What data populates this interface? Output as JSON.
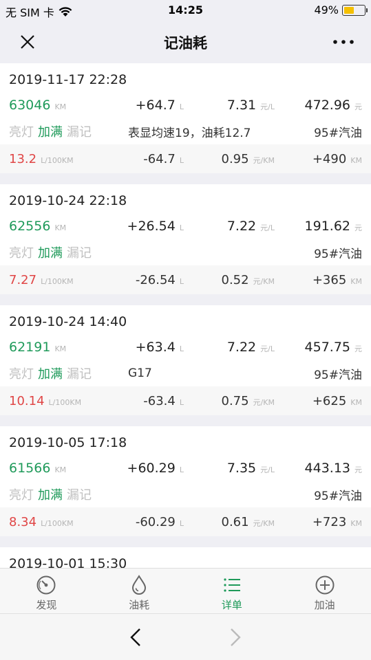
{
  "status_bar": {
    "carrier": "无 SIM 卡",
    "time": "14:25",
    "battery": "49%",
    "battery_level": 0.49
  },
  "nav": {
    "title": "记油耗"
  },
  "tags": {
    "light": "亮灯",
    "full": "加满",
    "missed": "漏记"
  },
  "units": {
    "km": "KM",
    "liter": "L",
    "price": "元/L",
    "yuan": "元",
    "consumption": "L/100KM",
    "cost_per_km": "元/KM"
  },
  "records": [
    {
      "datetime": "2019-11-17 22:28",
      "odometer": "63046",
      "liters": "+64.7",
      "price": "7.31",
      "amount": "472.96",
      "note": "表显均速19，油耗12.7",
      "fuel_type": "95#汽油",
      "consumption": "13.2",
      "liters_used": "-64.7",
      "cost_per_km": "0.95",
      "distance": "+490"
    },
    {
      "datetime": "2019-10-24 22:18",
      "odometer": "62556",
      "liters": "+26.54",
      "price": "7.22",
      "amount": "191.62",
      "note": "",
      "fuel_type": "95#汽油",
      "consumption": "7.27",
      "liters_used": "-26.54",
      "cost_per_km": "0.52",
      "distance": "+365"
    },
    {
      "datetime": "2019-10-24 14:40",
      "odometer": "62191",
      "liters": "+63.4",
      "price": "7.22",
      "amount": "457.75",
      "note": "G17",
      "fuel_type": "95#汽油",
      "consumption": "10.14",
      "liters_used": "-63.4",
      "cost_per_km": "0.75",
      "distance": "+625"
    },
    {
      "datetime": "2019-10-05 17:18",
      "odometer": "61566",
      "liters": "+60.29",
      "price": "7.35",
      "amount": "443.13",
      "note": "",
      "fuel_type": "95#汽油",
      "consumption": "8.34",
      "liters_used": "-60.29",
      "cost_per_km": "0.61",
      "distance": "+723"
    },
    {
      "datetime": "2019-10-01 15:30"
    }
  ],
  "tabs": [
    {
      "label": "发现",
      "icon": "gauge-icon"
    },
    {
      "label": "油耗",
      "icon": "drop-icon"
    },
    {
      "label": "详单",
      "icon": "list-icon",
      "active": true
    },
    {
      "label": "加油",
      "icon": "plus-circle-icon"
    }
  ],
  "colors": {
    "accent_green": "#1f9a5a",
    "consumption_red": "#e04646",
    "battery_yellow": "#f5c000"
  }
}
